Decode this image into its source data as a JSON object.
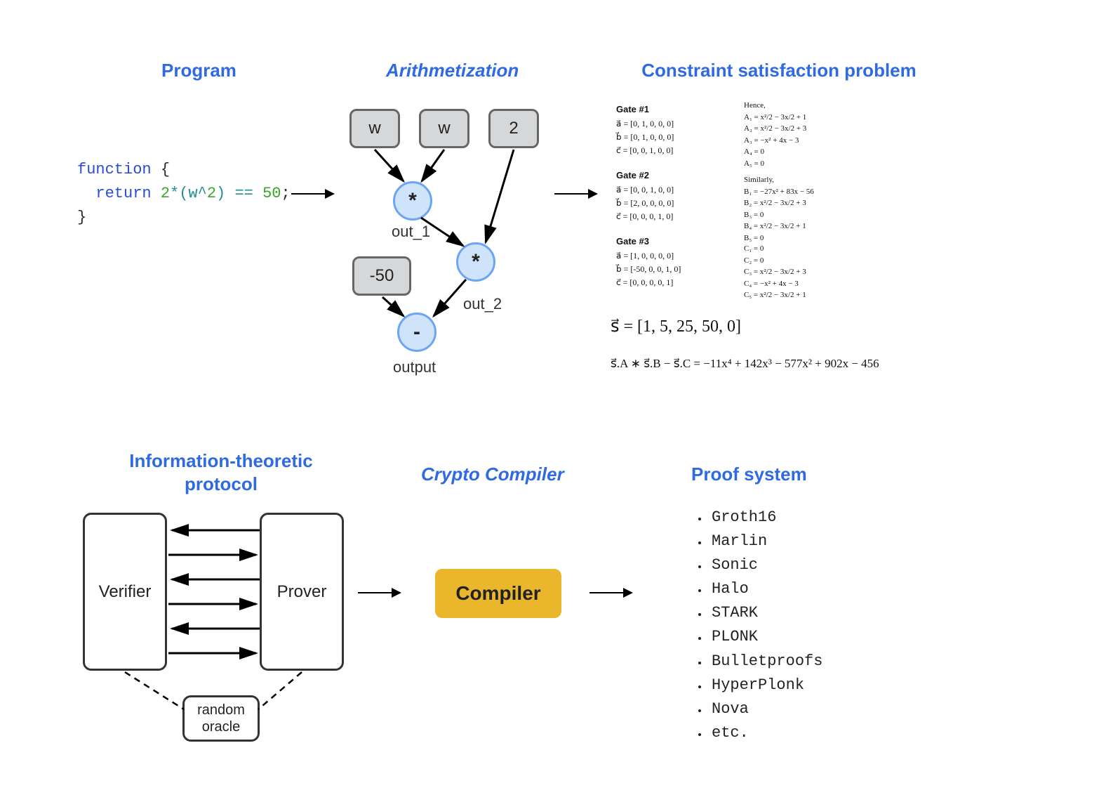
{
  "titles": {
    "program": "Program",
    "arithmetization": "Arithmetization",
    "csp": "Constraint satisfaction problem",
    "itp_line1": "Information-theoretic",
    "itp_line2": "protocol",
    "compiler_title": "Crypto Compiler",
    "proofsystem": "Proof system"
  },
  "code": {
    "l1a": "function",
    "l1b": " {",
    "l2a": "  return ",
    "l2b": "2",
    "l2c": "*(w^",
    "l2d": "2",
    "l2e": ") == ",
    "l2f": "50",
    "l2g": ";",
    "l3": "}"
  },
  "circuit": {
    "w1": "w",
    "w2": "w",
    "two": "2",
    "neg50": "-50",
    "star1": "*",
    "star2": "*",
    "minus": "-",
    "out1": "out_1",
    "out2": "out_2",
    "output": "output"
  },
  "csp": {
    "gate1_head": "Gate #1",
    "gate1_a": "a⃗ = [0, 1, 0, 0, 0]",
    "gate1_b": "b⃗ = [0, 1, 0, 0, 0]",
    "gate1_c": "c⃗ = [0, 0, 1, 0, 0]",
    "gate2_head": "Gate #2",
    "gate2_a": "a⃗ = [0, 0, 1, 0, 0]",
    "gate2_b": "b⃗ = [2, 0, 0, 0, 0]",
    "gate2_c": "c⃗ = [0, 0, 0, 1, 0]",
    "gate3_head": "Gate #3",
    "gate3_a": "a⃗ = [1, 0, 0, 0, 0]",
    "gate3_b": "b⃗ = [-50, 0, 0, 1, 0]",
    "gate3_c": "c⃗ = [0, 0, 0, 0, 1]",
    "hence": "Hence,",
    "a1": "A₁ = x²/2 − 3x/2 + 1",
    "a2": "A₂ = x²/2 − 3x/2 + 3",
    "a3": "A₃ = −x² + 4x − 3",
    "a4": "A₄ = 0",
    "a5": "A₅ = 0",
    "sim": "Similarly,",
    "b1": "B₁ = −27x² + 83x − 56",
    "b2": "B₂ = x²/2 − 3x/2 + 3",
    "b3": "B₃ = 0",
    "b4": "B₄ = x²/2 − 3x/2 + 1",
    "b5": "B₅ = 0",
    "c1": "C₁ = 0",
    "c2": "C₂ = 0",
    "c3": "C₃ = x²/2 − 3x/2 + 3",
    "c4": "C₄ = −x² + 4x − 3",
    "c5": "C₅ = x²/2 − 3x/2 + 1",
    "s_vec": "s⃗ = [1, 5, 25, 50, 0]",
    "poly": "s⃗.A ∗ s⃗.B − s⃗.C = −11x⁴ + 142x³ − 577x² + 902x − 456"
  },
  "protocol": {
    "verifier": "Verifier",
    "prover": "Prover",
    "random_l1": "random",
    "random_l2": "oracle"
  },
  "compiler": {
    "label": "Compiler"
  },
  "proofs": [
    "Groth16",
    "Marlin",
    "Sonic",
    "Halo",
    "STARK",
    "PLONK",
    "Bulletproofs",
    "HyperPlonk",
    "Nova",
    "etc."
  ]
}
